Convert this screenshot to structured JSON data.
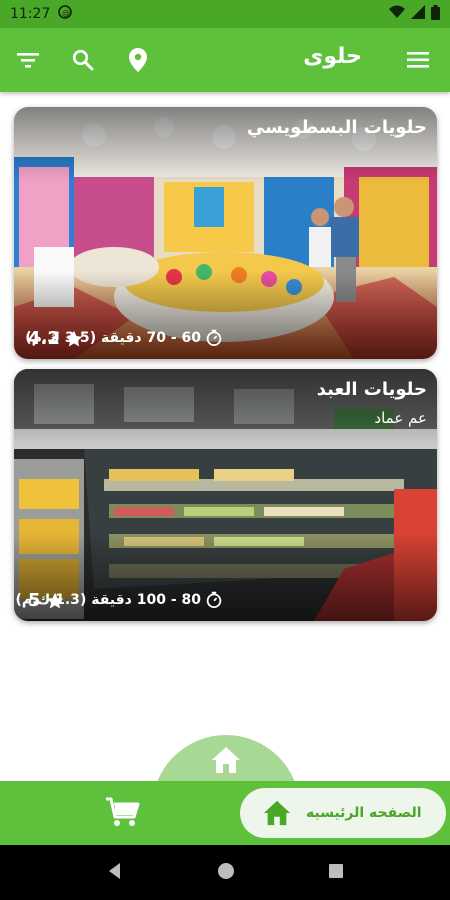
{
  "status": {
    "time": "11:27"
  },
  "appbar": {
    "title": "حلوى"
  },
  "restaurants": [
    {
      "name": "حلويات البسطويسي",
      "rating": "4.2",
      "eta": "60 - 70 دقيقة (3.5 ك.م)"
    },
    {
      "name": "حلويات العبد",
      "location": "عم عماد",
      "rating": "5",
      "eta": "80 - 100 دقيقة (1.3 ك.م)"
    }
  ],
  "bottom_nav": {
    "home_label": "الصفحه الرئيسيه"
  },
  "colors": {
    "primary": "#5dc13b",
    "primary_dark": "#4aa828",
    "bump": "#a7d995"
  }
}
